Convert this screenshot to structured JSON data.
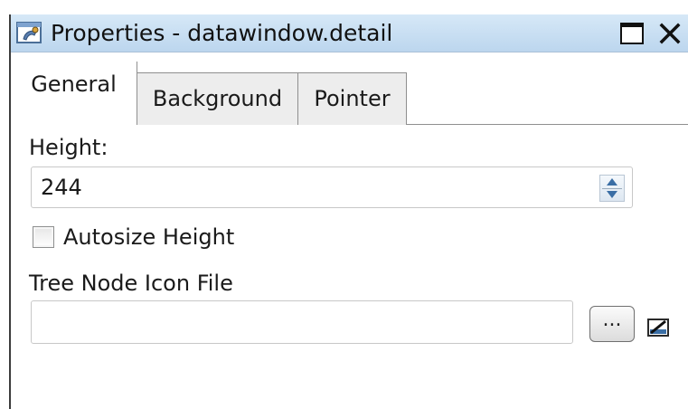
{
  "window": {
    "title": "Properties - datawindow.detail",
    "controls": {
      "maximize": "maximize",
      "close": "✕"
    }
  },
  "tabs": [
    {
      "label": "General",
      "active": true
    },
    {
      "label": "Background",
      "active": false
    },
    {
      "label": "Pointer",
      "active": false
    }
  ],
  "general": {
    "height_label": "Height:",
    "height_value": "244",
    "autosize_label": "Autosize Height",
    "autosize_checked": false,
    "tree_icon_label": "Tree Node Icon File",
    "tree_icon_value": "",
    "browse_label": "..."
  },
  "icons": {
    "app": "properties-icon",
    "spinner": "spinner-icon",
    "edit": "edit-icon"
  },
  "colors": {
    "titlebar": "#bcd6ee",
    "inactive_tab": "#ededed",
    "spinner_arrow": "#3a6ea5"
  }
}
